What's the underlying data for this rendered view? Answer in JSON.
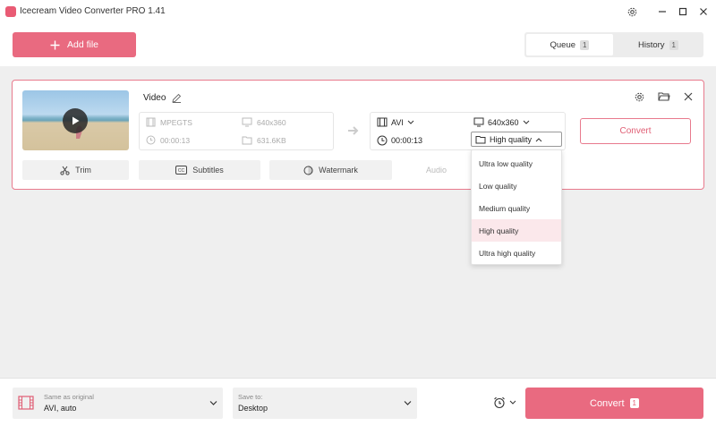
{
  "app": {
    "title": "Icecream Video Converter PRO 1.41"
  },
  "header": {
    "add_file": "Add file",
    "tabs": [
      {
        "label": "Queue",
        "count": "1",
        "active": true
      },
      {
        "label": "History",
        "count": "1",
        "active": false
      }
    ]
  },
  "item": {
    "name": "Video",
    "source": {
      "format": "MPEGTS",
      "resolution": "640x360",
      "duration": "00:00:13",
      "size": "631.6KB"
    },
    "target": {
      "format": "AVI",
      "resolution": "640x360",
      "duration": "00:00:13",
      "quality": "High quality"
    },
    "convert": "Convert",
    "tools": {
      "trim": "Trim",
      "subtitles": "Subtitles",
      "watermark": "Watermark",
      "audio": "Audio"
    }
  },
  "quality_menu": {
    "options": [
      "Ultra low quality",
      "Low quality",
      "Medium quality",
      "High quality",
      "Ultra high quality"
    ],
    "selected": "High quality"
  },
  "footer": {
    "profile": {
      "caption": "Same as original",
      "value": "AVI, auto"
    },
    "save_to": {
      "caption": "Save to:",
      "value": "Desktop"
    },
    "convert": "Convert",
    "convert_count": "1"
  },
  "colors": {
    "accent": "#e96a80",
    "accent_border": "#e87a8d",
    "selected_option": "#fbe8eb"
  }
}
